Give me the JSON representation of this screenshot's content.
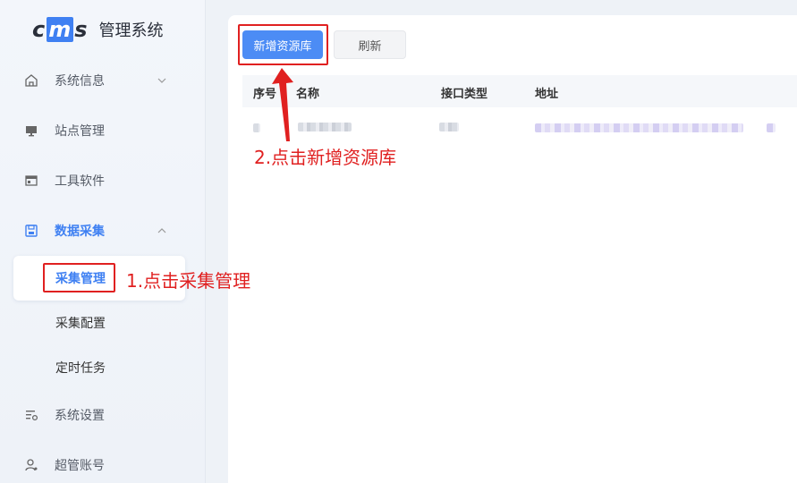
{
  "app": {
    "logo_text": "cms",
    "title": "管理系统"
  },
  "sidebar": {
    "items": [
      {
        "label": "系统信息",
        "icon": "home-icon"
      },
      {
        "label": "站点管理",
        "icon": "monitor-icon"
      },
      {
        "label": "工具软件",
        "icon": "window-icon"
      },
      {
        "label": "数据采集",
        "icon": "save-icon"
      },
      {
        "label": "系统设置",
        "icon": "settings-icon"
      },
      {
        "label": "超管账号",
        "icon": "user-icon"
      }
    ],
    "sub_items": [
      {
        "label": "采集管理"
      },
      {
        "label": "采集配置"
      },
      {
        "label": "定时任务"
      }
    ],
    "accent": "#3f80f2"
  },
  "toolbar": {
    "add_label": "新增资源库",
    "refresh_label": "刷新"
  },
  "table": {
    "columns": [
      "序号",
      "名称",
      "接口类型",
      "地址"
    ]
  },
  "annotations": {
    "step1": "1.点击采集管理",
    "step2": "2.点击新增资源库",
    "color": "#e02020"
  }
}
